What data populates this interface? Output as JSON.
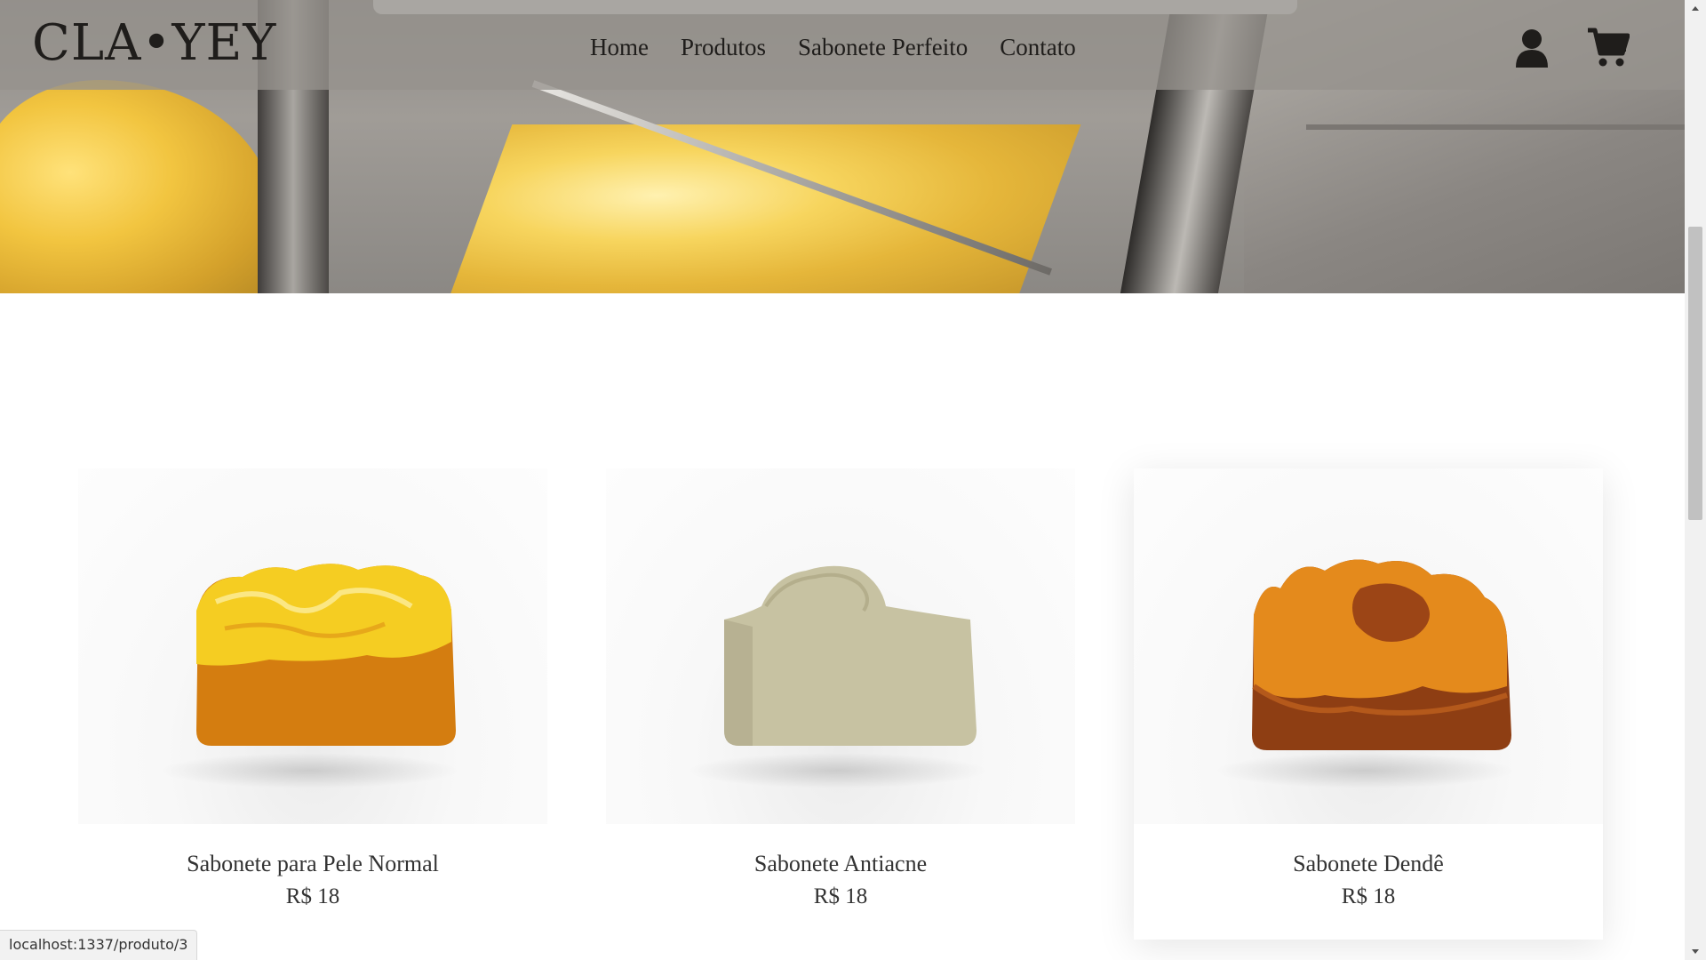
{
  "header": {
    "logo": "CLA•YEY",
    "nav": [
      "Home",
      "Produtos",
      "Sabonete Perfeito",
      "Contato"
    ],
    "icons": [
      "user-icon",
      "cart-icon"
    ]
  },
  "products": [
    {
      "name": "Sabonete para Pele Normal",
      "price": "R$ 18",
      "colors": [
        "#f5c81f",
        "#d27a0c"
      ]
    },
    {
      "name": "Sabonete Antiacne",
      "price": "R$ 18",
      "colors": [
        "#c8c4a4",
        "#bdb792"
      ]
    },
    {
      "name": "Sabonete Dendê",
      "price": "R$ 18",
      "colors": [
        "#e2891a",
        "#8e3d12"
      ]
    }
  ],
  "status_bar": {
    "url": "localhost:1337/produto/3"
  },
  "colors": {
    "header_bg": "#96928d",
    "text": "#1f1d1b"
  }
}
